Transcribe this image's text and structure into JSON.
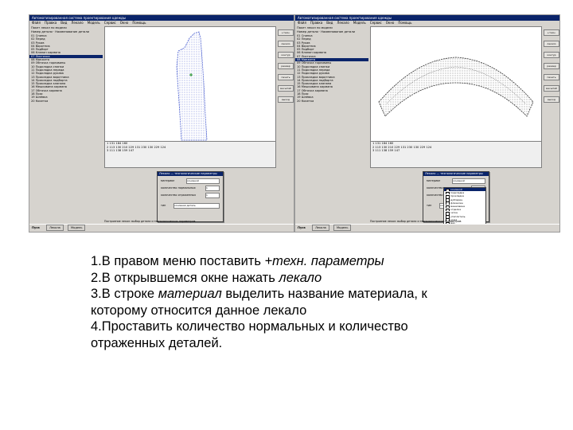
{
  "left_screen": {
    "window_title": "Автоматизированная система проектирования одежды",
    "menu_items": [
      "Файл",
      "Правка",
      "Вид",
      "Лекало",
      "Модель",
      "Сервис",
      "Окно",
      "Помощь"
    ],
    "panel_header": "Пакет лекал по модели",
    "panel_subheader": "Номер детали  ·  Наименование детали",
    "rows": [
      "01  Спинка",
      "02  Перед",
      "03  Рукав",
      "04  Воротник",
      "05  Подборт",
      "06  Клапан кармана",
      "07  Листочка",
      "08  Манжета",
      "09  Обтачка горловины",
      "10  Подкладка спинки",
      "11  Подкладка переда",
      "12  Подкладка рукава",
      "13  Прокладка воротника",
      "14  Прокладка подборта",
      "15  Прокладка клапана",
      "16  Мешковина кармана",
      "17  Обтачка кармана",
      "18  Пояс",
      "19  Шлёвка",
      "20  Кокетка"
    ],
    "selected_row": 6,
    "right_buttons": [
      "+техн. параметры",
      "лекало",
      "контур",
      "размер",
      "печать",
      "масштаб",
      "выход"
    ],
    "console_lines": [
      "1  131  184  160",
      "2  113  130  210  229  131  230  130  229  124",
      "3  111  138  159  147"
    ],
    "dialog": {
      "title": "Лекало — технологические параметры",
      "label_material": "материал",
      "label_normal": "количество нормальных",
      "label_mirrored": "количество отраженных",
      "label_type": "тип",
      "field_material": "основной",
      "field_normal": "1",
      "field_mirrored": "1",
      "field_type": "основная деталь"
    },
    "status_text": "Построение лекал: выбор детали и технологических параметров",
    "taskbar": {
      "start": "Пуск",
      "item1": "Лекала",
      "item2": "Модель"
    }
  },
  "right_screen": {
    "window_title": "Автоматизированная система проектирования одежды",
    "menu_items": [
      "Файл",
      "Правка",
      "Вид",
      "Лекало",
      "Модель",
      "Сервис",
      "Окно",
      "Помощь"
    ],
    "panel_header": "Пакет лекал по модели",
    "panel_subheader": "Номер детали  ·  Наименование детали",
    "rows": [
      "01  Спинка",
      "02  Перед",
      "03  Рукав",
      "04  Воротник",
      "05  Подборт",
      "06  Клапан кармана",
      "07  Листочка",
      "08  Манжета",
      "09  Обтачка горловины",
      "10  Подкладка спинки",
      "11  Подкладка переда",
      "12  Подкладка рукава",
      "13  Прокладка воротника",
      "14  Прокладка подборта",
      "15  Прокладка клапана",
      "16  Мешковина кармана",
      "17  Обтачка кармана",
      "18  Пояс",
      "19  Шлёвка",
      "20  Кокетка"
    ],
    "selected_row": 7,
    "right_buttons": [
      "+техн. параметры",
      "лекало",
      "контур",
      "размер",
      "печать",
      "масштаб",
      "выход"
    ],
    "console_lines": [
      "1  131  184  160",
      "2  113  130  210  229  131  230  130  229  124",
      "3  111  138  159  147"
    ],
    "dialog": {
      "title": "Лекало — технологические параметры",
      "label_material": "материал",
      "label_normal": "количество нормальных",
      "label_mirrored": "количество отраженных",
      "label_type": "тип",
      "field_material": "основной",
      "field_normal": "1",
      "field_mirrored": "1",
      "field_type": "основная деталь"
    },
    "material_options": [
      "основной",
      "подкладка",
      "прокладка",
      "дублерин",
      "флизелин",
      "мешковина",
      "отделка",
      "сетка",
      "утеплитель",
      "кожа",
      "мех",
      "трикотаж",
      "бязь",
      "тесьма"
    ],
    "material_selected": 0,
    "status_text": "Построение лекал: выбор детали и технологических параметров",
    "taskbar": {
      "start": "Пуск",
      "item1": "Лекала",
      "item2": "Модель"
    }
  },
  "instructions": {
    "step1_prefix": "1.В правом меню поставить ",
    "step1_em": "+техн. параметры",
    "step2_prefix": "2.В открывшемся окне нажать ",
    "step2_em": "лекало",
    "step3_prefix": "3.В строке ",
    "step3_em": "материал",
    "step3_suffix": " выделить название материала, к",
    "step3_cont": "которому относится данное лекало",
    "step4_line1": "4.Проставить количество нормальных и количество",
    "step4_line2": "отраженных деталей."
  }
}
